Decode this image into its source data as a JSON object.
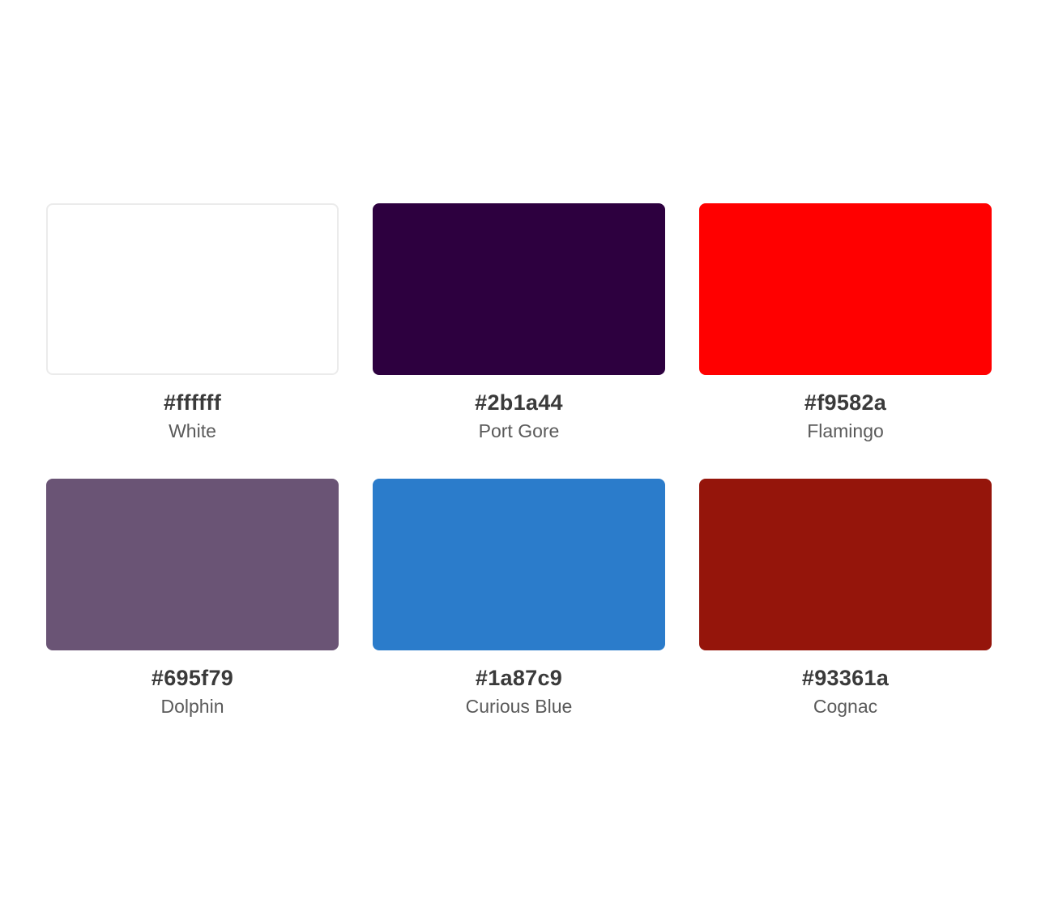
{
  "swatches": [
    {
      "hex": "#ffffff",
      "name": "White",
      "color": "#ffffff",
      "light": true
    },
    {
      "hex": "#2b1a44",
      "name": "Port Gore",
      "color": "#2d003f"
    },
    {
      "hex": "#f9582a",
      "name": "Flamingo",
      "color": "#ff0000"
    },
    {
      "hex": "#695f79",
      "name": "Dolphin",
      "color": "#6a5475"
    },
    {
      "hex": "#1a87c9",
      "name": "Curious Blue",
      "color": "#2b7ccb"
    },
    {
      "hex": "#93361a",
      "name": "Cognac",
      "color": "#95150b"
    }
  ]
}
